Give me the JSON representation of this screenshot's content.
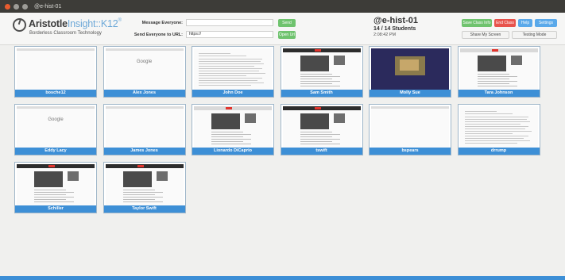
{
  "window": {
    "title": "@e-hist-01"
  },
  "brand": {
    "name_bold": "Aristotle",
    "name_light": "Insight::K12",
    "trademark": "®",
    "tagline": "Borderless Classroom Technology"
  },
  "toolbar": {
    "message_label": "Message Everyone:",
    "message_value": "",
    "send_label": "Send",
    "url_label": "Send Everyone to URL:",
    "url_value": "https://",
    "open_url_label": "Open Url"
  },
  "class_info": {
    "name": "@e-hist-01",
    "students": "14 / 14 Students",
    "time": "2:08:42 PM"
  },
  "actions": {
    "save_class": "Save Class Info",
    "end_class": "End Class",
    "help": "Help",
    "settings": "Settings",
    "share_screen": "Share My Screen",
    "testing_mode": "Testing Mode"
  },
  "colors": {
    "accent": "#3d8fd6",
    "green": "#6fc36e",
    "red": "#e8534c",
    "blue": "#5aa9ea",
    "titlebar": "#3d3c38"
  },
  "students": [
    {
      "name": "bosche12",
      "screen": "plain"
    },
    {
      "name": "Alex Jones",
      "screen": "google"
    },
    {
      "name": "John Doe",
      "screen": "doc"
    },
    {
      "name": "Sam Smith",
      "screen": "web"
    },
    {
      "name": "Molly Sue",
      "screen": "video"
    },
    {
      "name": "Tara Johnson",
      "screen": "web-light"
    },
    {
      "name": "Eddy Lacy",
      "screen": "google"
    },
    {
      "name": "James Jones",
      "screen": "plain"
    },
    {
      "name": "Lionardo DiCaprio",
      "screen": "web-light"
    },
    {
      "name": "tswift",
      "screen": "web"
    },
    {
      "name": "bspears",
      "screen": "plain"
    },
    {
      "name": "drrump",
      "screen": "doc"
    },
    {
      "name": "Schiller",
      "screen": "web"
    },
    {
      "name": "Taylor Swift",
      "screen": "web"
    }
  ],
  "google_text": "Google"
}
